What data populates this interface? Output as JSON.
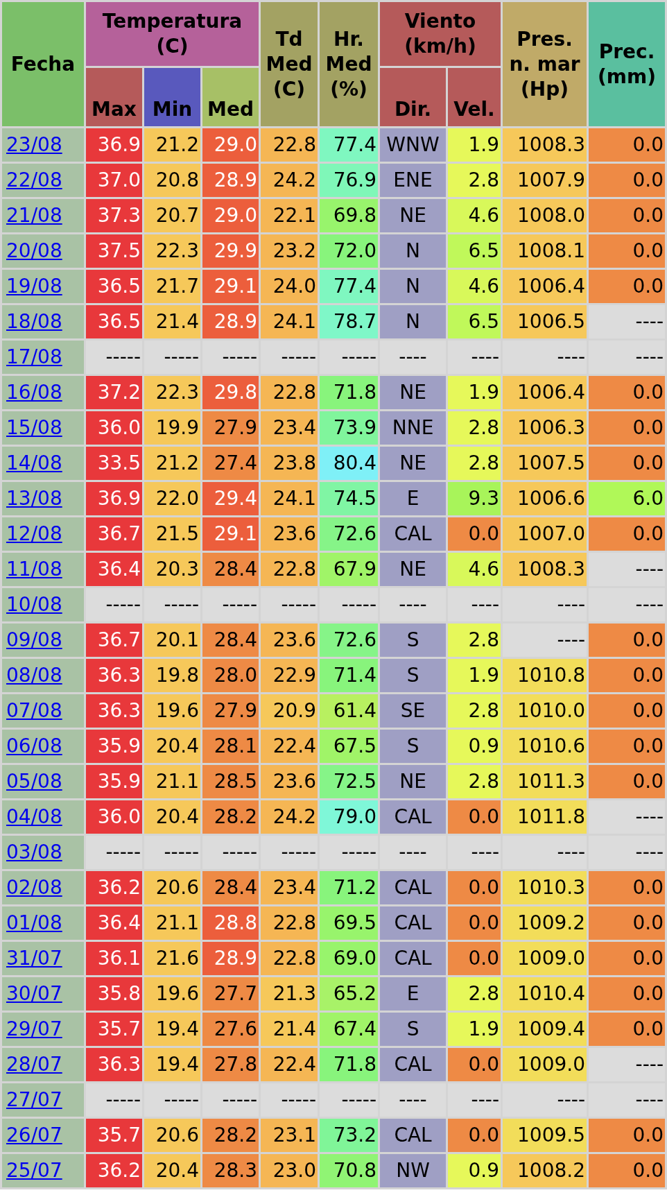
{
  "columns": [
    {
      "label": "Fecha",
      "color": "#7bbf69"
    },
    {
      "label": "Temperatura (C)",
      "color": "#b5619a",
      "children": [
        {
          "label": "Max",
          "color": "#b55a5a"
        },
        {
          "label": "Min",
          "color": "#5959bd"
        },
        {
          "label": "Med",
          "color": "#a7c066"
        }
      ]
    },
    {
      "label": "Td Med (C)",
      "color": "#a3a263"
    },
    {
      "label": "Hr. Med (%)",
      "color": "#a3a263"
    },
    {
      "label": "Viento (km/h)",
      "color": "#b55a5a",
      "children": [
        {
          "label": "Dir.",
          "color": "#b55a5a"
        },
        {
          "label": "Vel.",
          "color": "#b55a5a"
        }
      ]
    },
    {
      "label": "Pres. n. mar (Hp)",
      "color": "#c0aa68"
    },
    {
      "label": "Prec. (mm)",
      "color": "#5abf9f"
    }
  ],
  "rows": [
    {
      "date": "23/08",
      "cells": [
        {
          "value": "36.9",
          "color": "#e8383b"
        },
        {
          "value": "21.2",
          "color": "#f6c85a"
        },
        {
          "value": "29.0",
          "color": "#ec5e3c"
        },
        {
          "value": "22.8",
          "color": "#f5b654"
        },
        {
          "value": "77.4",
          "color": "#7ff7c0"
        },
        {
          "value": "WNW",
          "color": "#9f9fc4"
        },
        {
          "value": "1.9",
          "color": "#e6f85a"
        },
        {
          "value": "1008.3",
          "color": "#f6c85a"
        },
        {
          "value": "0.0",
          "color": "#ee8a45"
        }
      ]
    },
    {
      "date": "22/08",
      "cells": [
        {
          "value": "37.0",
          "color": "#e8383b"
        },
        {
          "value": "20.8",
          "color": "#f6c85a"
        },
        {
          "value": "28.9",
          "color": "#ec5e3c"
        },
        {
          "value": "24.2",
          "color": "#f5b654"
        },
        {
          "value": "76.9",
          "color": "#7ff7b8"
        },
        {
          "value": "ENE",
          "color": "#9f9fc4"
        },
        {
          "value": "2.8",
          "color": "#e6f85a"
        },
        {
          "value": "1007.9",
          "color": "#f6c85a"
        },
        {
          "value": "0.0",
          "color": "#ee8a45"
        }
      ]
    },
    {
      "date": "21/08",
      "cells": [
        {
          "value": "37.3",
          "color": "#e8383b"
        },
        {
          "value": "20.7",
          "color": "#f6c85a"
        },
        {
          "value": "29.0",
          "color": "#ec5e3c"
        },
        {
          "value": "22.1",
          "color": "#f5b654"
        },
        {
          "value": "69.8",
          "color": "#98f46c"
        },
        {
          "value": "NE",
          "color": "#9f9fc4"
        },
        {
          "value": "4.6",
          "color": "#d8f85a"
        },
        {
          "value": "1008.0",
          "color": "#f6c85a"
        },
        {
          "value": "0.0",
          "color": "#ee8a45"
        }
      ]
    },
    {
      "date": "20/08",
      "cells": [
        {
          "value": "37.5",
          "color": "#e8383b"
        },
        {
          "value": "22.3",
          "color": "#f6c85a"
        },
        {
          "value": "29.9",
          "color": "#ec5e3c"
        },
        {
          "value": "23.2",
          "color": "#f5b654"
        },
        {
          "value": "72.0",
          "color": "#88f47c"
        },
        {
          "value": "N",
          "color": "#9f9fc4"
        },
        {
          "value": "6.5",
          "color": "#c0f85a"
        },
        {
          "value": "1008.1",
          "color": "#f6c85a"
        },
        {
          "value": "0.0",
          "color": "#ee8a45"
        }
      ]
    },
    {
      "date": "19/08",
      "cells": [
        {
          "value": "36.5",
          "color": "#e8383b"
        },
        {
          "value": "21.7",
          "color": "#f6c85a"
        },
        {
          "value": "29.1",
          "color": "#ec5e3c"
        },
        {
          "value": "24.0",
          "color": "#f5b654"
        },
        {
          "value": "77.4",
          "color": "#7ff7c0"
        },
        {
          "value": "N",
          "color": "#9f9fc4"
        },
        {
          "value": "4.6",
          "color": "#d8f85a"
        },
        {
          "value": "1006.4",
          "color": "#f6c85a"
        },
        {
          "value": "0.0",
          "color": "#ee8a45"
        }
      ]
    },
    {
      "date": "18/08",
      "cells": [
        {
          "value": "36.5",
          "color": "#e8383b"
        },
        {
          "value": "21.4",
          "color": "#f6c85a"
        },
        {
          "value": "28.9",
          "color": "#ec5e3c"
        },
        {
          "value": "24.1",
          "color": "#f5b654"
        },
        {
          "value": "78.7",
          "color": "#7ff7c8"
        },
        {
          "value": "N",
          "color": "#9f9fc4"
        },
        {
          "value": "6.5",
          "color": "#c0f85a"
        },
        {
          "value": "1006.5",
          "color": "#f6c85a"
        },
        {
          "value": "----",
          "color": "#dcdcdc"
        }
      ]
    },
    {
      "date": "17/08",
      "cells": [
        {
          "value": "-----",
          "color": "#dcdcdc"
        },
        {
          "value": "-----",
          "color": "#dcdcdc"
        },
        {
          "value": "-----",
          "color": "#dcdcdc"
        },
        {
          "value": "-----",
          "color": "#dcdcdc"
        },
        {
          "value": "-----",
          "color": "#dcdcdc"
        },
        {
          "value": "----",
          "color": "#dcdcdc"
        },
        {
          "value": "----",
          "color": "#dcdcdc"
        },
        {
          "value": "----",
          "color": "#dcdcdc"
        },
        {
          "value": "----",
          "color": "#dcdcdc"
        }
      ]
    },
    {
      "date": "16/08",
      "cells": [
        {
          "value": "37.2",
          "color": "#e8383b"
        },
        {
          "value": "22.3",
          "color": "#f6c85a"
        },
        {
          "value": "29.8",
          "color": "#ec5e3c"
        },
        {
          "value": "22.8",
          "color": "#f5b654"
        },
        {
          "value": "71.8",
          "color": "#88f47c"
        },
        {
          "value": "NE",
          "color": "#9f9fc4"
        },
        {
          "value": "1.9",
          "color": "#e6f85a"
        },
        {
          "value": "1006.4",
          "color": "#f6c85a"
        },
        {
          "value": "0.0",
          "color": "#ee8a45"
        }
      ]
    },
    {
      "date": "15/08",
      "cells": [
        {
          "value": "36.0",
          "color": "#e8383b"
        },
        {
          "value": "19.9",
          "color": "#f6c85a"
        },
        {
          "value": "27.9",
          "color": "#ee8a45"
        },
        {
          "value": "23.4",
          "color": "#f5b654"
        },
        {
          "value": "73.9",
          "color": "#80f59c"
        },
        {
          "value": "NNE",
          "color": "#9f9fc4"
        },
        {
          "value": "2.8",
          "color": "#e6f85a"
        },
        {
          "value": "1006.3",
          "color": "#f6c85a"
        },
        {
          "value": "0.0",
          "color": "#ee8a45"
        }
      ]
    },
    {
      "date": "14/08",
      "cells": [
        {
          "value": "33.5",
          "color": "#e8383b"
        },
        {
          "value": "21.2",
          "color": "#f6c85a"
        },
        {
          "value": "27.4",
          "color": "#ee8a45"
        },
        {
          "value": "23.8",
          "color": "#f5b654"
        },
        {
          "value": "80.4",
          "color": "#7ff0f7"
        },
        {
          "value": "NE",
          "color": "#9f9fc4"
        },
        {
          "value": "2.8",
          "color": "#e6f85a"
        },
        {
          "value": "1007.5",
          "color": "#f6c85a"
        },
        {
          "value": "0.0",
          "color": "#ee8a45"
        }
      ]
    },
    {
      "date": "13/08",
      "cells": [
        {
          "value": "36.9",
          "color": "#e8383b"
        },
        {
          "value": "22.0",
          "color": "#f6c85a"
        },
        {
          "value": "29.4",
          "color": "#ec5e3c"
        },
        {
          "value": "24.1",
          "color": "#f5b654"
        },
        {
          "value": "74.5",
          "color": "#80f5a4"
        },
        {
          "value": "E",
          "color": "#9f9fc4"
        },
        {
          "value": "9.3",
          "color": "#a8f45a"
        },
        {
          "value": "1006.6",
          "color": "#f6c85a"
        },
        {
          "value": "6.0",
          "color": "#b0f858"
        }
      ]
    },
    {
      "date": "12/08",
      "cells": [
        {
          "value": "36.7",
          "color": "#e8383b"
        },
        {
          "value": "21.5",
          "color": "#f6c85a"
        },
        {
          "value": "29.1",
          "color": "#ec5e3c"
        },
        {
          "value": "23.6",
          "color": "#f5b654"
        },
        {
          "value": "72.6",
          "color": "#86f488"
        },
        {
          "value": "CAL",
          "color": "#9f9fc4"
        },
        {
          "value": "0.0",
          "color": "#ee8a45"
        },
        {
          "value": "1007.0",
          "color": "#f6c85a"
        },
        {
          "value": "0.0",
          "color": "#ee8a45"
        }
      ]
    },
    {
      "date": "11/08",
      "cells": [
        {
          "value": "36.4",
          "color": "#e8383b"
        },
        {
          "value": "20.3",
          "color": "#f6c85a"
        },
        {
          "value": "28.4",
          "color": "#ee8a45"
        },
        {
          "value": "22.8",
          "color": "#f5b654"
        },
        {
          "value": "67.9",
          "color": "#a0f468"
        },
        {
          "value": "NE",
          "color": "#9f9fc4"
        },
        {
          "value": "4.6",
          "color": "#d8f85a"
        },
        {
          "value": "1008.3",
          "color": "#f6c85a"
        },
        {
          "value": "----",
          "color": "#dcdcdc"
        }
      ]
    },
    {
      "date": "10/08",
      "cells": [
        {
          "value": "-----",
          "color": "#dcdcdc"
        },
        {
          "value": "-----",
          "color": "#dcdcdc"
        },
        {
          "value": "-----",
          "color": "#dcdcdc"
        },
        {
          "value": "-----",
          "color": "#dcdcdc"
        },
        {
          "value": "-----",
          "color": "#dcdcdc"
        },
        {
          "value": "----",
          "color": "#dcdcdc"
        },
        {
          "value": "----",
          "color": "#dcdcdc"
        },
        {
          "value": "----",
          "color": "#dcdcdc"
        },
        {
          "value": "----",
          "color": "#dcdcdc"
        }
      ]
    },
    {
      "date": "09/08",
      "cells": [
        {
          "value": "36.7",
          "color": "#e8383b"
        },
        {
          "value": "20.1",
          "color": "#f6c85a"
        },
        {
          "value": "28.4",
          "color": "#ee8a45"
        },
        {
          "value": "23.6",
          "color": "#f5b654"
        },
        {
          "value": "72.6",
          "color": "#86f488"
        },
        {
          "value": "S",
          "color": "#9f9fc4"
        },
        {
          "value": "2.8",
          "color": "#e6f85a"
        },
        {
          "value": "----",
          "color": "#dcdcdc"
        },
        {
          "value": "0.0",
          "color": "#ee8a45"
        }
      ]
    },
    {
      "date": "08/08",
      "cells": [
        {
          "value": "36.3",
          "color": "#e8383b"
        },
        {
          "value": "19.8",
          "color": "#f6c85a"
        },
        {
          "value": "28.0",
          "color": "#ee8a45"
        },
        {
          "value": "22.9",
          "color": "#f5b654"
        },
        {
          "value": "71.4",
          "color": "#88f47c"
        },
        {
          "value": "S",
          "color": "#9f9fc4"
        },
        {
          "value": "1.9",
          "color": "#e6f85a"
        },
        {
          "value": "1010.8",
          "color": "#f2dd5a"
        },
        {
          "value": "0.0",
          "color": "#ee8a45"
        }
      ]
    },
    {
      "date": "07/08",
      "cells": [
        {
          "value": "36.3",
          "color": "#e8383b"
        },
        {
          "value": "19.6",
          "color": "#f6c85a"
        },
        {
          "value": "27.9",
          "color": "#ee8a45"
        },
        {
          "value": "20.9",
          "color": "#f6c85a"
        },
        {
          "value": "61.4",
          "color": "#b8f060"
        },
        {
          "value": "SE",
          "color": "#9f9fc4"
        },
        {
          "value": "2.8",
          "color": "#e6f85a"
        },
        {
          "value": "1010.0",
          "color": "#f2dd5a"
        },
        {
          "value": "0.0",
          "color": "#ee8a45"
        }
      ]
    },
    {
      "date": "06/08",
      "cells": [
        {
          "value": "35.9",
          "color": "#e8383b"
        },
        {
          "value": "20.4",
          "color": "#f6c85a"
        },
        {
          "value": "28.1",
          "color": "#ee8a45"
        },
        {
          "value": "22.4",
          "color": "#f5b654"
        },
        {
          "value": "67.5",
          "color": "#a0f468"
        },
        {
          "value": "S",
          "color": "#9f9fc4"
        },
        {
          "value": "0.9",
          "color": "#e6f85a"
        },
        {
          "value": "1010.6",
          "color": "#f2dd5a"
        },
        {
          "value": "0.0",
          "color": "#ee8a45"
        }
      ]
    },
    {
      "date": "05/08",
      "cells": [
        {
          "value": "35.9",
          "color": "#e8383b"
        },
        {
          "value": "21.1",
          "color": "#f6c85a"
        },
        {
          "value": "28.5",
          "color": "#ee8a45"
        },
        {
          "value": "23.6",
          "color": "#f5b654"
        },
        {
          "value": "72.5",
          "color": "#86f488"
        },
        {
          "value": "NE",
          "color": "#9f9fc4"
        },
        {
          "value": "2.8",
          "color": "#e6f85a"
        },
        {
          "value": "1011.3",
          "color": "#f2dd5a"
        },
        {
          "value": "0.0",
          "color": "#ee8a45"
        }
      ]
    },
    {
      "date": "04/08",
      "cells": [
        {
          "value": "36.0",
          "color": "#e8383b"
        },
        {
          "value": "20.4",
          "color": "#f6c85a"
        },
        {
          "value": "28.2",
          "color": "#ee8a45"
        },
        {
          "value": "24.2",
          "color": "#f5b654"
        },
        {
          "value": "79.0",
          "color": "#7ff7d8"
        },
        {
          "value": "CAL",
          "color": "#9f9fc4"
        },
        {
          "value": "0.0",
          "color": "#ee8a45"
        },
        {
          "value": "1011.8",
          "color": "#f2dd5a"
        },
        {
          "value": "----",
          "color": "#dcdcdc"
        }
      ]
    },
    {
      "date": "03/08",
      "cells": [
        {
          "value": "-----",
          "color": "#dcdcdc"
        },
        {
          "value": "-----",
          "color": "#dcdcdc"
        },
        {
          "value": "-----",
          "color": "#dcdcdc"
        },
        {
          "value": "-----",
          "color": "#dcdcdc"
        },
        {
          "value": "-----",
          "color": "#dcdcdc"
        },
        {
          "value": "----",
          "color": "#dcdcdc"
        },
        {
          "value": "----",
          "color": "#dcdcdc"
        },
        {
          "value": "----",
          "color": "#dcdcdc"
        },
        {
          "value": "----",
          "color": "#dcdcdc"
        }
      ]
    },
    {
      "date": "02/08",
      "cells": [
        {
          "value": "36.2",
          "color": "#e8383b"
        },
        {
          "value": "20.6",
          "color": "#f6c85a"
        },
        {
          "value": "28.4",
          "color": "#ee8a45"
        },
        {
          "value": "23.4",
          "color": "#f5b654"
        },
        {
          "value": "71.2",
          "color": "#88f47c"
        },
        {
          "value": "CAL",
          "color": "#9f9fc4"
        },
        {
          "value": "0.0",
          "color": "#ee8a45"
        },
        {
          "value": "1010.3",
          "color": "#f2dd5a"
        },
        {
          "value": "0.0",
          "color": "#ee8a45"
        }
      ]
    },
    {
      "date": "01/08",
      "cells": [
        {
          "value": "36.4",
          "color": "#e8383b"
        },
        {
          "value": "21.1",
          "color": "#f6c85a"
        },
        {
          "value": "28.8",
          "color": "#ec5e3c"
        },
        {
          "value": "22.8",
          "color": "#f5b654"
        },
        {
          "value": "69.5",
          "color": "#98f46c"
        },
        {
          "value": "CAL",
          "color": "#9f9fc4"
        },
        {
          "value": "0.0",
          "color": "#ee8a45"
        },
        {
          "value": "1009.2",
          "color": "#f2dd5a"
        },
        {
          "value": "0.0",
          "color": "#ee8a45"
        }
      ]
    },
    {
      "date": "31/07",
      "cells": [
        {
          "value": "36.1",
          "color": "#e8383b"
        },
        {
          "value": "21.6",
          "color": "#f6c85a"
        },
        {
          "value": "28.9",
          "color": "#ec5e3c"
        },
        {
          "value": "22.8",
          "color": "#f5b654"
        },
        {
          "value": "69.0",
          "color": "#98f46c"
        },
        {
          "value": "CAL",
          "color": "#9f9fc4"
        },
        {
          "value": "0.0",
          "color": "#ee8a45"
        },
        {
          "value": "1009.0",
          "color": "#f2dd5a"
        },
        {
          "value": "0.0",
          "color": "#ee8a45"
        }
      ]
    },
    {
      "date": "30/07",
      "cells": [
        {
          "value": "35.8",
          "color": "#e8383b"
        },
        {
          "value": "19.6",
          "color": "#f6c85a"
        },
        {
          "value": "27.7",
          "color": "#ee8a45"
        },
        {
          "value": "21.3",
          "color": "#f6c85a"
        },
        {
          "value": "65.2",
          "color": "#a8f268"
        },
        {
          "value": "E",
          "color": "#9f9fc4"
        },
        {
          "value": "2.8",
          "color": "#e6f85a"
        },
        {
          "value": "1010.4",
          "color": "#f2dd5a"
        },
        {
          "value": "0.0",
          "color": "#ee8a45"
        }
      ]
    },
    {
      "date": "29/07",
      "cells": [
        {
          "value": "35.7",
          "color": "#e8383b"
        },
        {
          "value": "19.4",
          "color": "#f6c85a"
        },
        {
          "value": "27.6",
          "color": "#ee8a45"
        },
        {
          "value": "21.4",
          "color": "#f6c85a"
        },
        {
          "value": "67.4",
          "color": "#a0f468"
        },
        {
          "value": "S",
          "color": "#9f9fc4"
        },
        {
          "value": "1.9",
          "color": "#e6f85a"
        },
        {
          "value": "1009.4",
          "color": "#f2dd5a"
        },
        {
          "value": "0.0",
          "color": "#ee8a45"
        }
      ]
    },
    {
      "date": "28/07",
      "cells": [
        {
          "value": "36.3",
          "color": "#e8383b"
        },
        {
          "value": "19.4",
          "color": "#f6c85a"
        },
        {
          "value": "27.8",
          "color": "#ee8a45"
        },
        {
          "value": "22.4",
          "color": "#f5b654"
        },
        {
          "value": "71.8",
          "color": "#88f47c"
        },
        {
          "value": "CAL",
          "color": "#9f9fc4"
        },
        {
          "value": "0.0",
          "color": "#ee8a45"
        },
        {
          "value": "1009.0",
          "color": "#f2dd5a"
        },
        {
          "value": "----",
          "color": "#dcdcdc"
        }
      ]
    },
    {
      "date": "27/07",
      "cells": [
        {
          "value": "-----",
          "color": "#dcdcdc"
        },
        {
          "value": "-----",
          "color": "#dcdcdc"
        },
        {
          "value": "-----",
          "color": "#dcdcdc"
        },
        {
          "value": "-----",
          "color": "#dcdcdc"
        },
        {
          "value": "-----",
          "color": "#dcdcdc"
        },
        {
          "value": "----",
          "color": "#dcdcdc"
        },
        {
          "value": "----",
          "color": "#dcdcdc"
        },
        {
          "value": "----",
          "color": "#dcdcdc"
        },
        {
          "value": "----",
          "color": "#dcdcdc"
        }
      ]
    },
    {
      "date": "26/07",
      "cells": [
        {
          "value": "35.7",
          "color": "#e8383b"
        },
        {
          "value": "20.6",
          "color": "#f6c85a"
        },
        {
          "value": "28.2",
          "color": "#ee8a45"
        },
        {
          "value": "23.1",
          "color": "#f5b654"
        },
        {
          "value": "73.2",
          "color": "#80f598"
        },
        {
          "value": "CAL",
          "color": "#9f9fc4"
        },
        {
          "value": "0.0",
          "color": "#ee8a45"
        },
        {
          "value": "1009.5",
          "color": "#f2dd5a"
        },
        {
          "value": "0.0",
          "color": "#ee8a45"
        }
      ]
    },
    {
      "date": "25/07",
      "cells": [
        {
          "value": "36.2",
          "color": "#e8383b"
        },
        {
          "value": "20.4",
          "color": "#f6c85a"
        },
        {
          "value": "28.3",
          "color": "#ee8a45"
        },
        {
          "value": "23.0",
          "color": "#f5b654"
        },
        {
          "value": "70.8",
          "color": "#90f474"
        },
        {
          "value": "NW",
          "color": "#9f9fc4"
        },
        {
          "value": "0.9",
          "color": "#e6f85a"
        },
        {
          "value": "1008.2",
          "color": "#f6c85a"
        },
        {
          "value": "0.0",
          "color": "#ee8a45"
        }
      ]
    }
  ]
}
